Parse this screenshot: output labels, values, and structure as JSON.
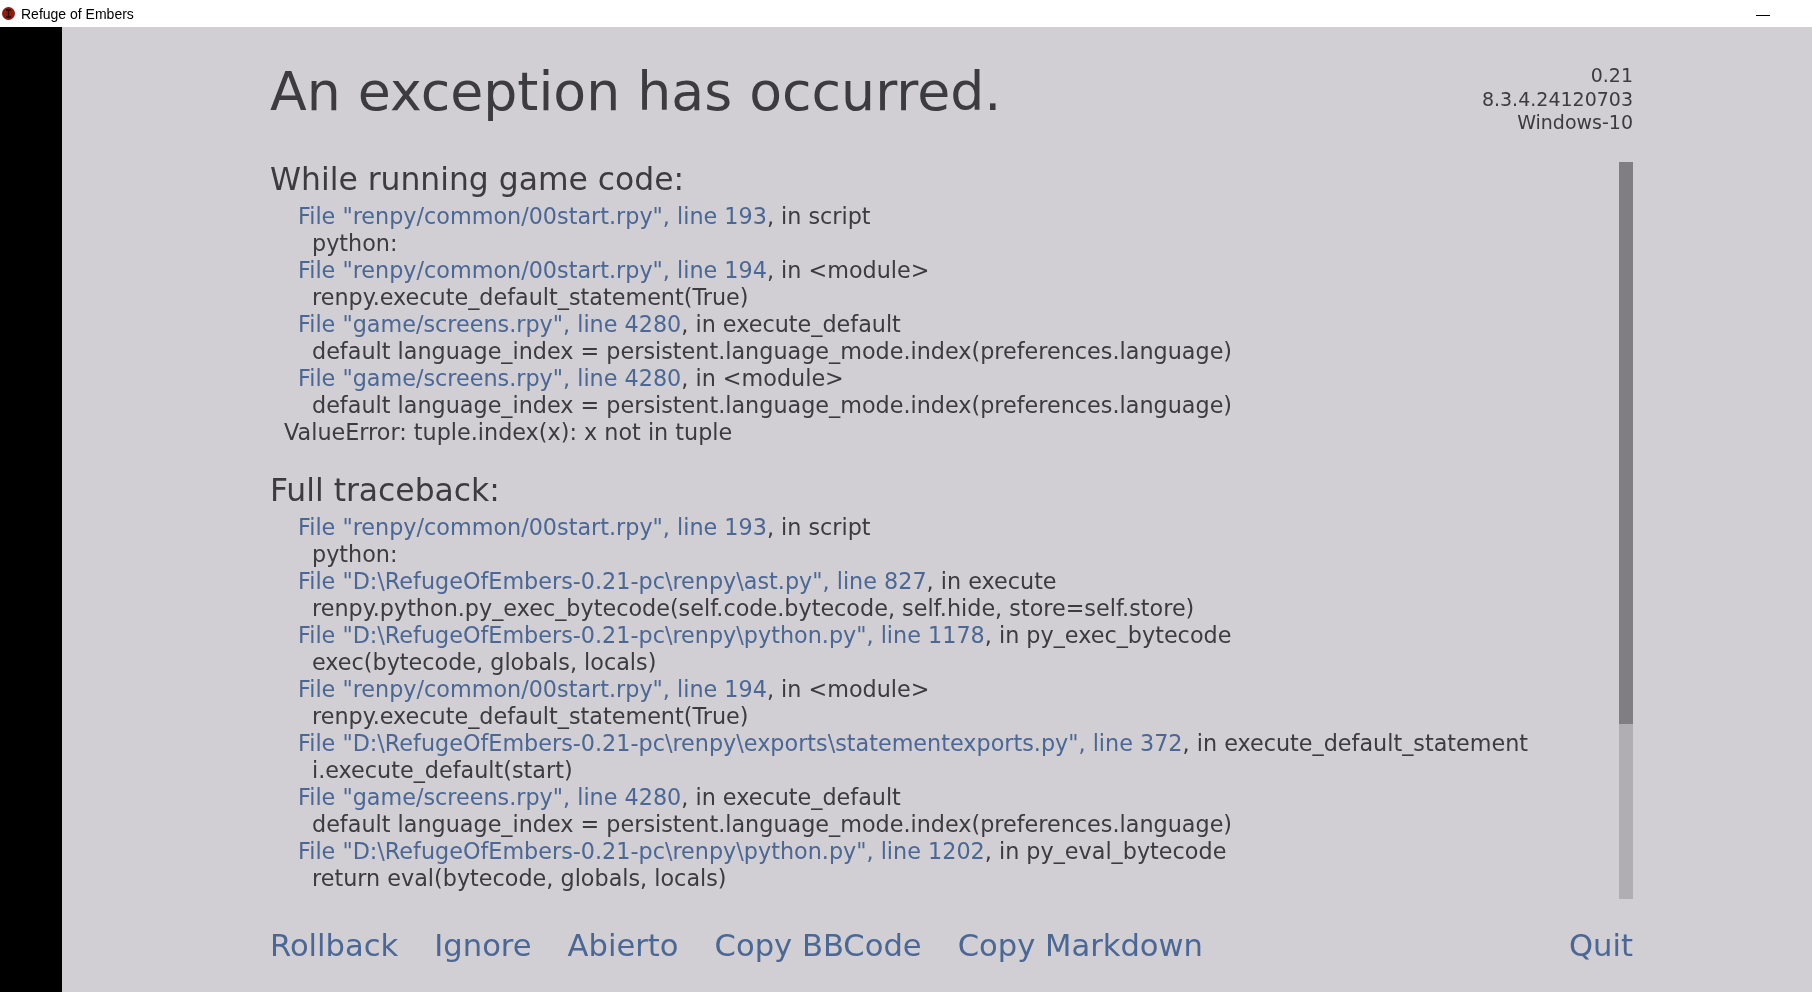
{
  "window": {
    "title": "Refuge of Embers",
    "controls": [
      "—"
    ]
  },
  "title": "An exception has occurred.",
  "version_info": [
    "0.21",
    "8.3.4.24120703",
    "Windows-10"
  ],
  "sections": [
    {
      "heading": "While running game code:",
      "lines": [
        {
          "kind": "file",
          "link": "File \"renpy/common/00start.rpy\", line 193",
          "rest": ", in script"
        },
        {
          "kind": "code",
          "text": "python:"
        },
        {
          "kind": "file",
          "link": "File \"renpy/common/00start.rpy\", line 194",
          "rest": ", in <module>"
        },
        {
          "kind": "code",
          "text": "renpy.execute_default_statement(True)"
        },
        {
          "kind": "file",
          "link": "File \"game/screens.rpy\", line 4280",
          "rest": ", in execute_default"
        },
        {
          "kind": "code",
          "text": "default language_index = persistent.language_mode.index(preferences.language)"
        },
        {
          "kind": "file",
          "link": "File \"game/screens.rpy\", line 4280",
          "rest": ", in <module>"
        },
        {
          "kind": "code",
          "text": "default language_index = persistent.language_mode.index(preferences.language)"
        },
        {
          "kind": "error",
          "text": "ValueError: tuple.index(x): x not in tuple"
        }
      ]
    },
    {
      "heading": "Full traceback:",
      "lines": [
        {
          "kind": "file",
          "link": "File \"renpy/common/00start.rpy\", line 193",
          "rest": ", in script"
        },
        {
          "kind": "code",
          "text": "python:"
        },
        {
          "kind": "file",
          "link": "File \"D:\\RefugeOfEmbers-0.21-pc\\renpy\\ast.py\", line 827",
          "rest": ", in execute"
        },
        {
          "kind": "code",
          "text": "renpy.python.py_exec_bytecode(self.code.bytecode, self.hide, store=self.store)"
        },
        {
          "kind": "file",
          "link": "File \"D:\\RefugeOfEmbers-0.21-pc\\renpy\\python.py\", line 1178",
          "rest": ", in py_exec_bytecode"
        },
        {
          "kind": "code",
          "text": "exec(bytecode, globals, locals)"
        },
        {
          "kind": "file",
          "link": "File \"renpy/common/00start.rpy\", line 194",
          "rest": ", in <module>"
        },
        {
          "kind": "code",
          "text": "renpy.execute_default_statement(True)"
        },
        {
          "kind": "file",
          "link": "File \"D:\\RefugeOfEmbers-0.21-pc\\renpy\\exports\\statementexports.py\", line 372",
          "rest": ", in execute_default_statement"
        },
        {
          "kind": "code",
          "text": "i.execute_default(start)"
        },
        {
          "kind": "file",
          "link": "File \"game/screens.rpy\", line 4280",
          "rest": ", in execute_default"
        },
        {
          "kind": "code",
          "text": "default language_index = persistent.language_mode.index(preferences.language)"
        },
        {
          "kind": "file",
          "link": "File \"D:\\RefugeOfEmbers-0.21-pc\\renpy\\python.py\", line 1202",
          "rest": ", in py_eval_bytecode"
        },
        {
          "kind": "code",
          "text": "return eval(bytecode, globals, locals)"
        }
      ]
    }
  ],
  "buttons": [
    "Rollback",
    "Ignore",
    "Abierto",
    "Copy BBCode",
    "Copy Markdown"
  ],
  "quit_button": "Quit"
}
